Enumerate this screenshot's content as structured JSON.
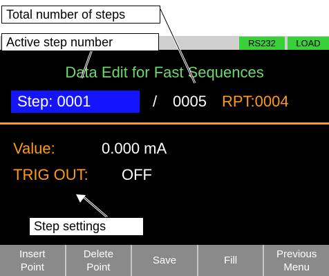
{
  "status": {
    "interface": "RS232",
    "mode": "LOAD"
  },
  "screen": {
    "title": "Data Edit for Fast Sequences",
    "step_label": "Step: 0001",
    "separator": "/",
    "total_steps": "0005",
    "repeat": "RPT:0004",
    "value_label": "Value:",
    "value": "0.000 mA",
    "trig_label": "TRIG OUT:",
    "trig_value": "OFF"
  },
  "softkeys": [
    {
      "line1": "Insert",
      "line2": "Point"
    },
    {
      "line1": "Delete",
      "line2": "Point"
    },
    {
      "line1": "Save",
      "line2": ""
    },
    {
      "line1": "Fill",
      "line2": ""
    },
    {
      "line1": "Previous",
      "line2": "Menu"
    }
  ],
  "callouts": {
    "total": "Total number of steps",
    "active": "Active step number",
    "settings": "Step settings"
  }
}
